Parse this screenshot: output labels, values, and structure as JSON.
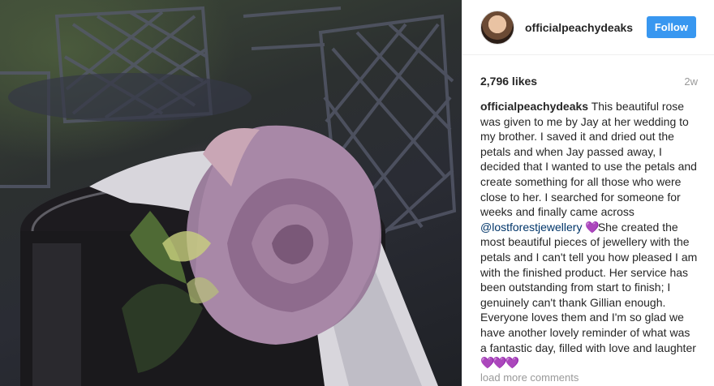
{
  "post": {
    "username": "officialpeachydeaks",
    "follow_label": "Follow",
    "likes": "2,796 likes",
    "time_ago": "2w",
    "caption_author": "officialpeachydeaks",
    "caption_part1": " This beautiful rose was given to me by Jay at her wedding to my brother. I saved it and dried out the petals and when Jay passed away, I decided that I wanted to use the petals and create something for all those who were close to her. I searched for someone for weeks and finally came across ",
    "mention": "@lostforestjewellery",
    "emoji_single": "💜",
    "caption_part2": "She created the most beautiful pieces of jewellery with the petals and I can't tell you how pleased I am with the finished product. Her service has been outstanding from start to finish; I genuinely can't thank Gillian enough. Everyone loves them and I'm so glad we have another lovely reminder of what was a fantastic day, filled with love and laughter ",
    "emoji_triple": "💜💜💜",
    "load_more": "load more comments"
  },
  "colors": {
    "follow_bg": "#3897f0",
    "mention": "#003569",
    "heart": "#a56ee0"
  }
}
